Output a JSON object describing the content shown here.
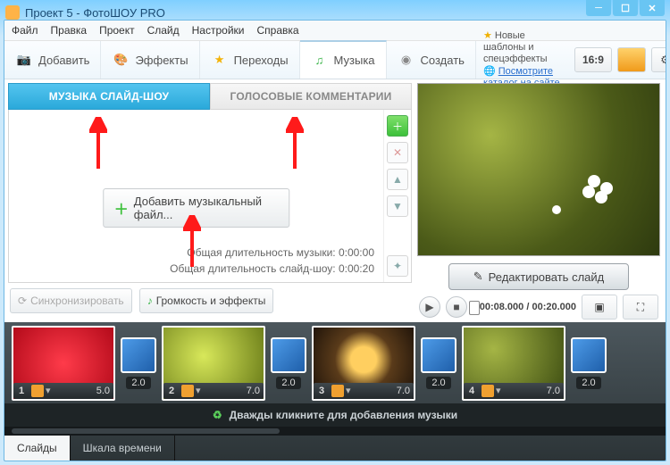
{
  "window": {
    "title": "Проект 5 - ФотоШОУ PRO"
  },
  "menu": [
    "Файл",
    "Правка",
    "Проект",
    "Слайд",
    "Настройки",
    "Справка"
  ],
  "ribbon": {
    "add": "Добавить",
    "effects": "Эффекты",
    "transitions": "Переходы",
    "music": "Музыка",
    "create": "Создать"
  },
  "promo": {
    "line": "Новые шаблоны и спецэффекты",
    "link": "Посмотрите каталог на сайте..."
  },
  "aspect": "16:9",
  "tabs": {
    "music": "МУЗЫКА СЛАЙД-ШОУ",
    "voice": "ГОЛОСОВЫЕ КОММЕНТАРИИ"
  },
  "add_music": "Добавить музыкальный файл...",
  "stats": {
    "music_label": "Общая длительность музыки:",
    "music_val": "0:00:00",
    "show_label": "Общая длительность слайд-шоу:",
    "show_val": "0:00:20"
  },
  "sync": "Синхронизировать",
  "volume": "Громкость и эффекты",
  "edit_slide": "Редактировать слайд",
  "time": {
    "cur": "00:08.000",
    "total": "00:20.000"
  },
  "slides": [
    {
      "n": "1",
      "dur": "5.0",
      "trans": "2.0"
    },
    {
      "n": "2",
      "dur": "7.0",
      "trans": "2.0"
    },
    {
      "n": "3",
      "dur": "7.0",
      "trans": "2.0"
    },
    {
      "n": "4",
      "dur": "7.0",
      "trans": "2.0"
    }
  ],
  "hint": "Дважды кликните для добавления музыки",
  "tl_tabs": {
    "slides": "Слайды",
    "scale": "Шкала времени"
  }
}
